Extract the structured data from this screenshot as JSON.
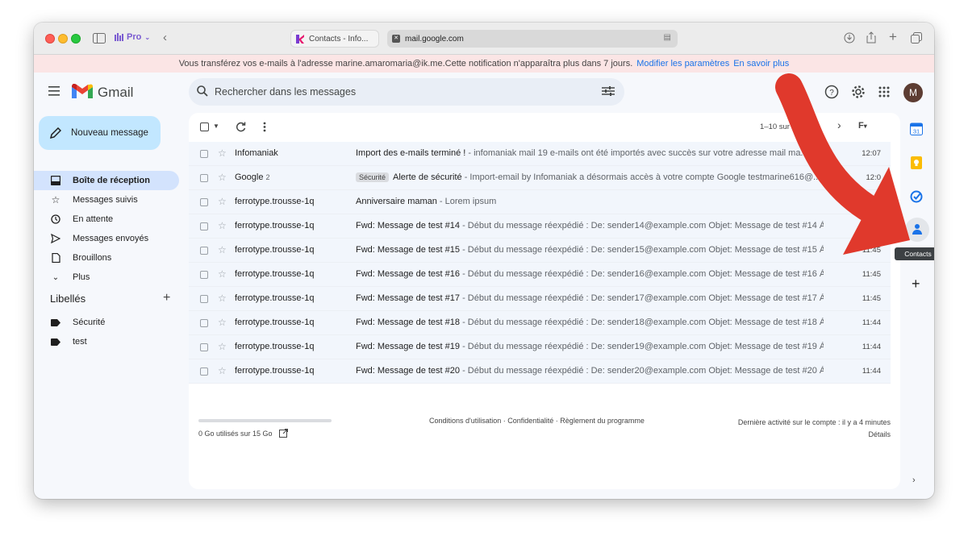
{
  "browser": {
    "profile_label": "Pro",
    "tab_title": "Contacts - Info...",
    "address": "mail.google.com"
  },
  "notification": {
    "text": "Vous transférez vos e-mails à l'adresse marine.amaromaria@ik.me.Cette notification n'apparaîtra plus dans 7 jours.",
    "link1": "Modifier les paramètres",
    "link2": "En savoir plus"
  },
  "gmail": {
    "logo_text": "Gmail",
    "search_placeholder": "Rechercher dans les messages",
    "avatar_letter": "M"
  },
  "compose_label": "Nouveau message",
  "nav_items": [
    {
      "label": "Boîte de réception",
      "icon": "inbox-icon",
      "active": true
    },
    {
      "label": "Messages suivis",
      "icon": "star-icon",
      "active": false
    },
    {
      "label": "En attente",
      "icon": "clock-icon",
      "active": false
    },
    {
      "label": "Messages envoyés",
      "icon": "send-icon",
      "active": false
    },
    {
      "label": "Brouillons",
      "icon": "draft-icon",
      "active": false
    },
    {
      "label": "Plus",
      "icon": "chevron-down-icon",
      "active": false
    }
  ],
  "labels": {
    "title": "Libellés",
    "items": [
      "Sécurité",
      "test"
    ]
  },
  "pager": "1–10 sur",
  "emails": [
    {
      "sender": "Infomaniak",
      "count": "",
      "badge": "",
      "subject": "Import des e-mails terminé !",
      "snippet": " - infomaniak mail 19 e-mails ont été importés avec succès sur votre adresse mail ma...",
      "time": "12:07"
    },
    {
      "sender": "Google",
      "count": "2",
      "badge": "Sécurité",
      "subject": "Alerte de sécurité",
      "snippet": " - Import-email by Infomaniak a désormais accès à votre compte Google testmarine616@...",
      "time": "12:0"
    },
    {
      "sender": "ferrotype.trousse-1q",
      "count": "",
      "badge": "",
      "subject": "Anniversaire maman",
      "snippet": " - Lorem ipsum",
      "time": ""
    },
    {
      "sender": "ferrotype.trousse-1q",
      "count": "",
      "badge": "",
      "subject": "Fwd: Message de test #14",
      "snippet": " - Début du message réexpédié : De: sender14@example.com Objet: Message de test #14 À: te...",
      "time": ""
    },
    {
      "sender": "ferrotype.trousse-1q",
      "count": "",
      "badge": "",
      "subject": "Fwd: Message de test #15",
      "snippet": " - Début du message réexpédié : De: sender15@example.com Objet: Message de test #15 À: te...",
      "time": "11:45"
    },
    {
      "sender": "ferrotype.trousse-1q",
      "count": "",
      "badge": "",
      "subject": "Fwd: Message de test #16",
      "snippet": " - Début du message réexpédié : De: sender16@example.com Objet: Message de test #16 À: te...",
      "time": "11:45"
    },
    {
      "sender": "ferrotype.trousse-1q",
      "count": "",
      "badge": "",
      "subject": "Fwd: Message de test #17",
      "snippet": " - Début du message réexpédié : De: sender17@example.com Objet: Message de test #17 À: te...",
      "time": "11:45"
    },
    {
      "sender": "ferrotype.trousse-1q",
      "count": "",
      "badge": "",
      "subject": "Fwd: Message de test #18",
      "snippet": " - Début du message réexpédié : De: sender18@example.com Objet: Message de test #18 À: te...",
      "time": "11:44"
    },
    {
      "sender": "ferrotype.trousse-1q",
      "count": "",
      "badge": "",
      "subject": "Fwd: Message de test #19",
      "snippet": " - Début du message réexpédié : De: sender19@example.com Objet: Message de test #19 À: te...",
      "time": "11:44"
    },
    {
      "sender": "ferrotype.trousse-1q",
      "count": "",
      "badge": "",
      "subject": "Fwd: Message de test #20",
      "snippet": " - Début du message réexpédié : De: sender20@example.com Objet: Message de test #20 À: ...",
      "time": "11:44"
    }
  ],
  "footer": {
    "storage": "0 Go utilisés sur 15 Go",
    "links": "Conditions d'utilisation · Confidentialité · Règlement du programme",
    "activity": "Dernière activité sur le compte : il y a 4 minutes",
    "details": "Détails"
  },
  "side_panel": {
    "tooltip": "Contacts",
    "icons": [
      "calendar-icon",
      "keep-icon",
      "tasks-icon",
      "contacts-icon",
      "add-icon"
    ]
  },
  "colors": {
    "compose_bg": "#c2e7ff",
    "active_nav_bg": "#d3e3fd",
    "notification_bg": "#fbe5e5",
    "arrow": "#e0392c"
  }
}
